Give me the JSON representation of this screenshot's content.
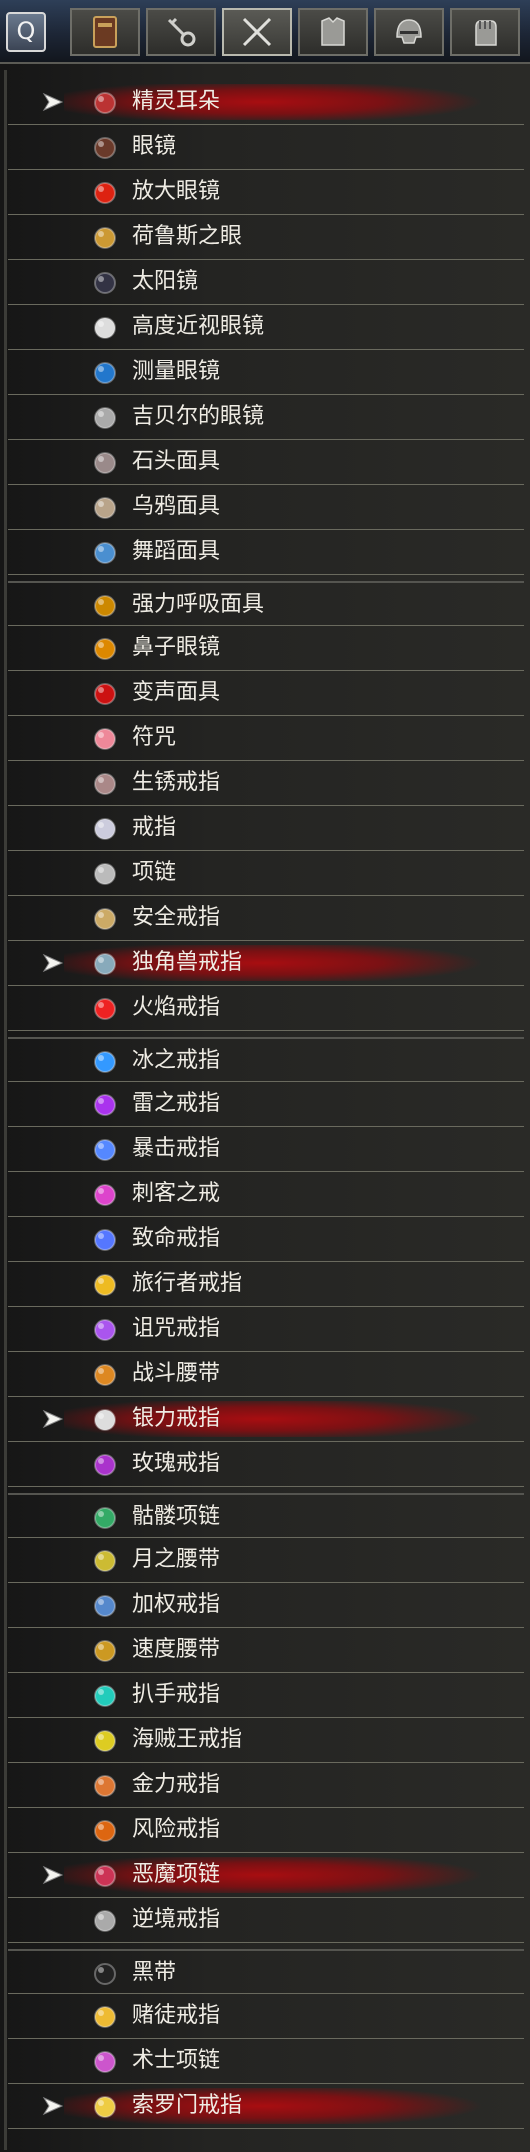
{
  "toolbar": {
    "search_label": "Q",
    "tabs": [
      {
        "icon": "book-icon"
      },
      {
        "icon": "key-icon"
      },
      {
        "icon": "crossed-swords-icon"
      },
      {
        "icon": "chest-armor-icon"
      },
      {
        "icon": "helmet-icon"
      },
      {
        "icon": "gauntlet-icon"
      }
    ]
  },
  "accent_color": "#a80c10",
  "items": [
    {
      "label": "精灵耳朵",
      "selected": true,
      "icon": "elf-ears-icon",
      "color": "#b33"
    },
    {
      "label": "眼镜",
      "selected": false,
      "icon": "eyeglasses-icon",
      "color": "#6a3a2a"
    },
    {
      "label": "放大眼镜",
      "selected": false,
      "icon": "magnifying-glasses-icon",
      "color": "#d21"
    },
    {
      "label": "荷鲁斯之眼",
      "selected": false,
      "icon": "eye-of-horus-icon",
      "color": "#c93"
    },
    {
      "label": "太阳镜",
      "selected": false,
      "icon": "sunglasses-icon",
      "color": "#334"
    },
    {
      "label": "高度近视眼镜",
      "selected": false,
      "icon": "thick-glasses-icon",
      "color": "#ddd"
    },
    {
      "label": "测量眼镜",
      "selected": false,
      "icon": "blue-lens-glasses-icon",
      "color": "#27c"
    },
    {
      "label": "吉贝尔的眼镜",
      "selected": false,
      "icon": "gilbert-glasses-icon",
      "color": "#aaa"
    },
    {
      "label": "石头面具",
      "selected": false,
      "icon": "stone-mask-icon",
      "color": "#9a8a8a"
    },
    {
      "label": "乌鸦面具",
      "selected": false,
      "icon": "crow-mask-icon",
      "color": "#b9a48a"
    },
    {
      "label": "舞蹈面具",
      "selected": false,
      "icon": "dance-mask-icon",
      "color": "#4a8fd0"
    },
    {
      "label": "强力呼吸面具",
      "selected": false,
      "icon": "breathing-mask-icon",
      "color": "#c80",
      "group_start": true
    },
    {
      "label": "鼻子眼镜",
      "selected": false,
      "icon": "nose-glasses-icon",
      "color": "#d80"
    },
    {
      "label": "变声面具",
      "selected": false,
      "icon": "voice-mask-icon",
      "color": "#c11"
    },
    {
      "label": "符咒",
      "selected": false,
      "icon": "talisman-icon",
      "color": "#e89"
    },
    {
      "label": "生锈戒指",
      "selected": false,
      "icon": "rusty-ring-icon",
      "color": "#a88"
    },
    {
      "label": "戒指",
      "selected": false,
      "icon": "ring-icon",
      "color": "#ccd"
    },
    {
      "label": "项链",
      "selected": false,
      "icon": "necklace-icon",
      "color": "#bbb"
    },
    {
      "label": "安全戒指",
      "selected": false,
      "icon": "safety-ring-icon",
      "color": "#ca6"
    },
    {
      "label": "独角兽戒指",
      "selected": true,
      "icon": "unicorn-ring-icon",
      "color": "#8ab"
    },
    {
      "label": "火焰戒指",
      "selected": false,
      "icon": "fire-ring-icon",
      "color": "#e22"
    },
    {
      "label": "冰之戒指",
      "selected": false,
      "icon": "ice-ring-icon",
      "color": "#39f",
      "group_start": true
    },
    {
      "label": "雷之戒指",
      "selected": false,
      "icon": "thunder-ring-icon",
      "color": "#a3e"
    },
    {
      "label": "暴击戒指",
      "selected": false,
      "icon": "critical-ring-icon",
      "color": "#58f"
    },
    {
      "label": "刺客之戒",
      "selected": false,
      "icon": "assassin-ring-icon",
      "color": "#d4c"
    },
    {
      "label": "致命戒指",
      "selected": false,
      "icon": "fatal-ring-icon",
      "color": "#57f"
    },
    {
      "label": "旅行者戒指",
      "selected": false,
      "icon": "traveler-ring-icon",
      "color": "#eb2"
    },
    {
      "label": "诅咒戒指",
      "selected": false,
      "icon": "curse-ring-icon",
      "color": "#a5e"
    },
    {
      "label": "战斗腰带",
      "selected": false,
      "icon": "battle-belt-icon",
      "color": "#d82"
    },
    {
      "label": "银力戒指",
      "selected": true,
      "icon": "silver-ring-icon",
      "color": "#ddd"
    },
    {
      "label": "玫瑰戒指",
      "selected": false,
      "icon": "rose-ring-icon",
      "color": "#a3c"
    },
    {
      "label": "骷髅项链",
      "selected": false,
      "icon": "skull-necklace-icon",
      "color": "#3a6",
      "group_start": true
    },
    {
      "label": "月之腰带",
      "selected": false,
      "icon": "moon-belt-icon",
      "color": "#cb3"
    },
    {
      "label": "加权戒指",
      "selected": false,
      "icon": "weighted-ring-icon",
      "color": "#58c"
    },
    {
      "label": "速度腰带",
      "selected": false,
      "icon": "speed-belt-icon",
      "color": "#c92"
    },
    {
      "label": "扒手戒指",
      "selected": false,
      "icon": "pickpocket-ring-icon",
      "color": "#2cb"
    },
    {
      "label": "海贼王戒指",
      "selected": false,
      "icon": "pirate-king-ring-icon",
      "color": "#dc2"
    },
    {
      "label": "金力戒指",
      "selected": false,
      "icon": "gold-ring-icon",
      "color": "#d73"
    },
    {
      "label": "风险戒指",
      "selected": false,
      "icon": "risk-ring-icon",
      "color": "#d61"
    },
    {
      "label": "恶魔项链",
      "selected": true,
      "icon": "demon-necklace-icon",
      "color": "#c35"
    },
    {
      "label": "逆境戒指",
      "selected": false,
      "icon": "adversity-ring-icon",
      "color": "#aaa"
    },
    {
      "label": "黑带",
      "selected": false,
      "icon": "black-belt-icon",
      "color": "#222",
      "group_start": true
    },
    {
      "label": "赌徒戒指",
      "selected": false,
      "icon": "gambler-ring-icon",
      "color": "#eb3"
    },
    {
      "label": "术士项链",
      "selected": false,
      "icon": "sorcerer-necklace-icon",
      "color": "#c5c"
    },
    {
      "label": "索罗门戒指",
      "selected": true,
      "icon": "solomon-ring-icon",
      "color": "#ec4"
    }
  ]
}
